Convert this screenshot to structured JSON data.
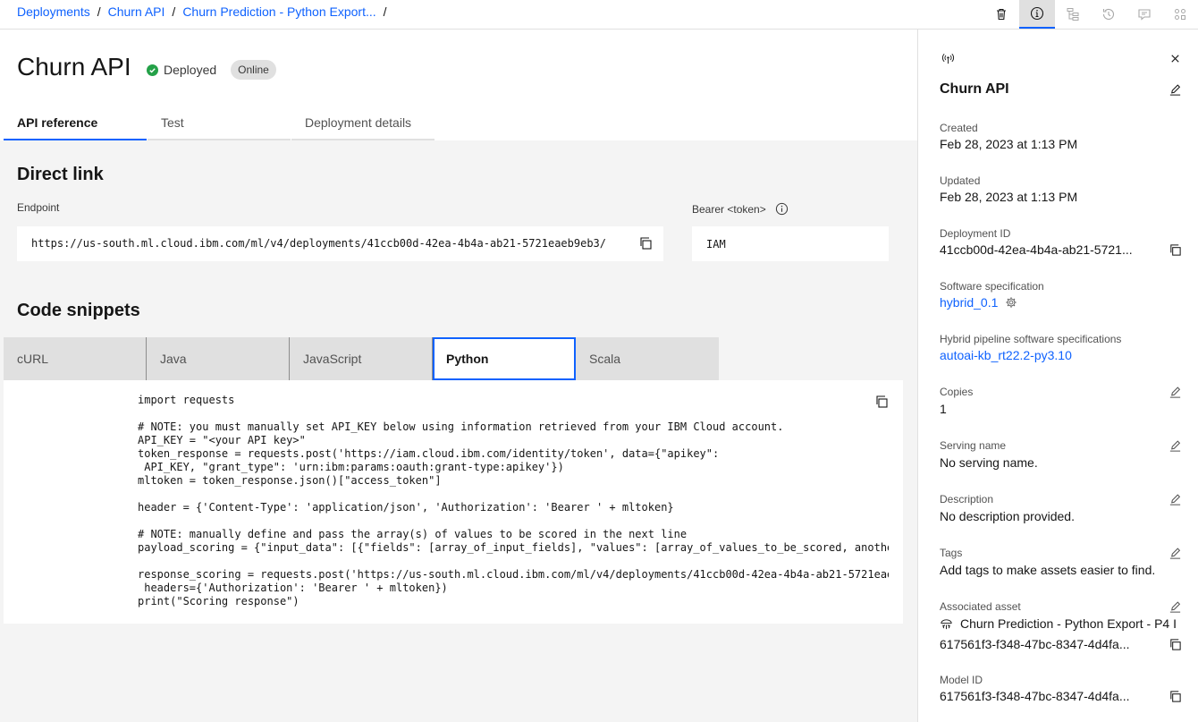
{
  "breadcrumbs": [
    "Deployments",
    "Churn API",
    "Churn Prediction - Python Export..."
  ],
  "toolbar_icons": [
    "trash-icon",
    "info-icon",
    "hierarchy-icon",
    "history-icon",
    "chat-icon",
    "apps-icon"
  ],
  "page": {
    "title": "Churn API",
    "status": "Deployed",
    "badge": "Online"
  },
  "tabs": [
    "API reference",
    "Test",
    "Deployment details"
  ],
  "direct_link": {
    "heading": "Direct link",
    "endpoint_label": "Endpoint",
    "endpoint_value": "https://us-south.ml.cloud.ibm.com/ml/v4/deployments/41ccb00d-42ea-4b4a-ab21-5721eaeb9eb3/",
    "bearer_label": "Bearer <token>",
    "bearer_value": "IAM"
  },
  "code_snippets": {
    "heading": "Code snippets",
    "tabs": [
      "cURL",
      "Java",
      "JavaScript",
      "Python",
      "Scala"
    ],
    "active_tab": "Python",
    "code": "import requests\n\n# NOTE: you must manually set API_KEY below using information retrieved from your IBM Cloud account.\nAPI_KEY = \"<your API key>\"\ntoken_response = requests.post('https://iam.cloud.ibm.com/identity/token', data={\"apikey\":\n API_KEY, \"grant_type\": 'urn:ibm:params:oauth:grant-type:apikey'})\nmltoken = token_response.json()[\"access_token\"]\n\nheader = {'Content-Type': 'application/json', 'Authorization': 'Bearer ' + mltoken}\n\n# NOTE: manually define and pass the array(s) of values to be scored in the next line\npayload_scoring = {\"input_data\": [{\"fields\": [array_of_input_fields], \"values\": [array_of_values_to_be_scored, another_array_of_values_to_be_scored]}]}\n\nresponse_scoring = requests.post('https://us-south.ml.cloud.ibm.com/ml/v4/deployments/41ccb00d-42ea-4b4a-ab21-5721eaeb9eb3/predictions?version=2021-05-01', json=payload_scoring,\n headers={'Authorization': 'Bearer ' + mltoken})\nprint(\"Scoring response\")"
  },
  "side_panel": {
    "name": "Churn API",
    "created_label": "Created",
    "created_value": "Feb 28, 2023 at 1:13 PM",
    "updated_label": "Updated",
    "updated_value": "Feb 28, 2023 at 1:13 PM",
    "deployment_id_label": "Deployment ID",
    "deployment_id_value": "41ccb00d-42ea-4b4a-ab21-5721...",
    "software_spec_label": "Software specification",
    "software_spec_value": "hybrid_0.1",
    "hybrid_label": "Hybrid pipeline software specifications",
    "hybrid_value": "autoai-kb_rt22.2-py3.10",
    "copies_label": "Copies",
    "copies_value": "1",
    "serving_label": "Serving name",
    "serving_value": "No serving name.",
    "description_label": "Description",
    "description_value": "No description provided.",
    "tags_label": "Tags",
    "tags_value": "Add tags to make assets easier to find.",
    "asset_label": "Associated asset",
    "asset_name": "Churn Prediction - Python Export - P4 I",
    "asset_id": "617561f3-f348-47bc-8347-4d4fa...",
    "model_id_label": "Model ID",
    "model_id_value": "617561f3-f348-47bc-8347-4d4fa..."
  },
  "colors": {
    "accent": "#0f62fe",
    "success": "#24a148"
  }
}
